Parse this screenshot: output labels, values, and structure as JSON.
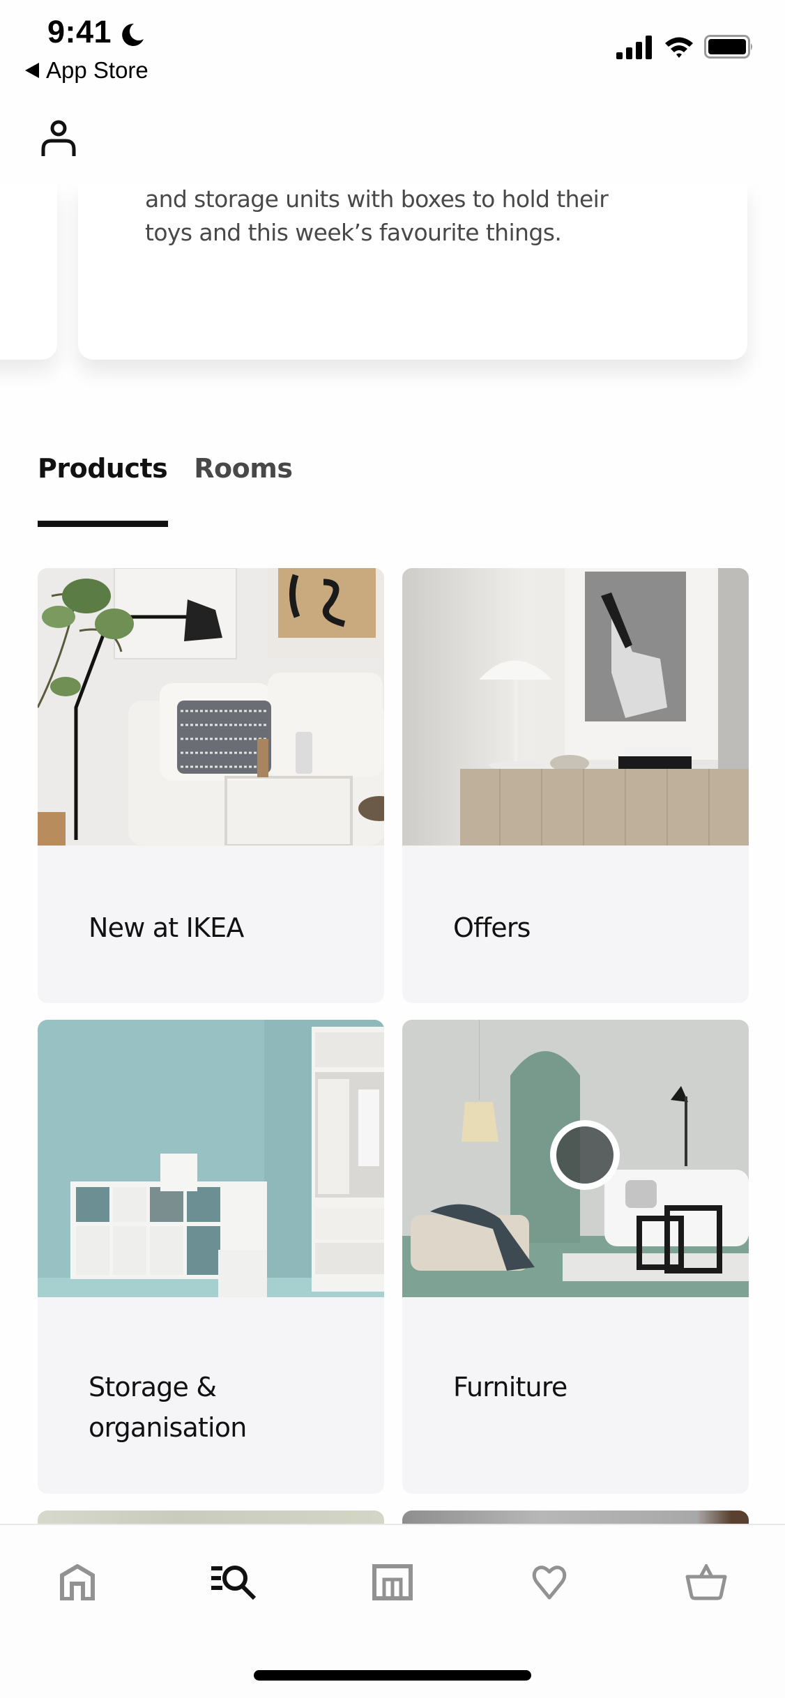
{
  "status_bar": {
    "time": "9:41",
    "focus_icon": "moon-icon",
    "back_label": "App Store",
    "signal_icon": "cellular-signal-icon",
    "wifi_icon": "wifi-icon",
    "battery_icon": "battery-icon"
  },
  "header": {
    "profile_icon": "person-icon"
  },
  "hero_card": {
    "text_line_1": "and storage units with boxes to hold their",
    "text_line_2": "toys and this week’s favourite things."
  },
  "tabs": [
    {
      "label": "Products",
      "active": true
    },
    {
      "label": "Rooms",
      "active": false
    }
  ],
  "categories": [
    {
      "label": "New at IKEA",
      "image": "living-room-sofa-photo"
    },
    {
      "label": "Offers",
      "image": "sideboard-lamp-photo"
    },
    {
      "label_line_1": "Storage &",
      "label_line_2": "organisation",
      "image": "shelving-storage-photo"
    },
    {
      "label": "Furniture",
      "image": "green-living-room-photo"
    }
  ],
  "bottom_nav": [
    {
      "name": "Home",
      "icon": "home-icon",
      "active": false
    },
    {
      "name": "Search",
      "icon": "search-icon",
      "active": true
    },
    {
      "name": "Stores",
      "icon": "store-icon",
      "active": false
    },
    {
      "name": "Favourites",
      "icon": "heart-icon",
      "active": false
    },
    {
      "name": "Basket",
      "icon": "basket-icon",
      "active": false
    }
  ],
  "colors": {
    "active_icon": "#111111",
    "inactive_icon": "#929292",
    "tile_background": "#f5f5f7",
    "text_secondary": "#484848"
  }
}
